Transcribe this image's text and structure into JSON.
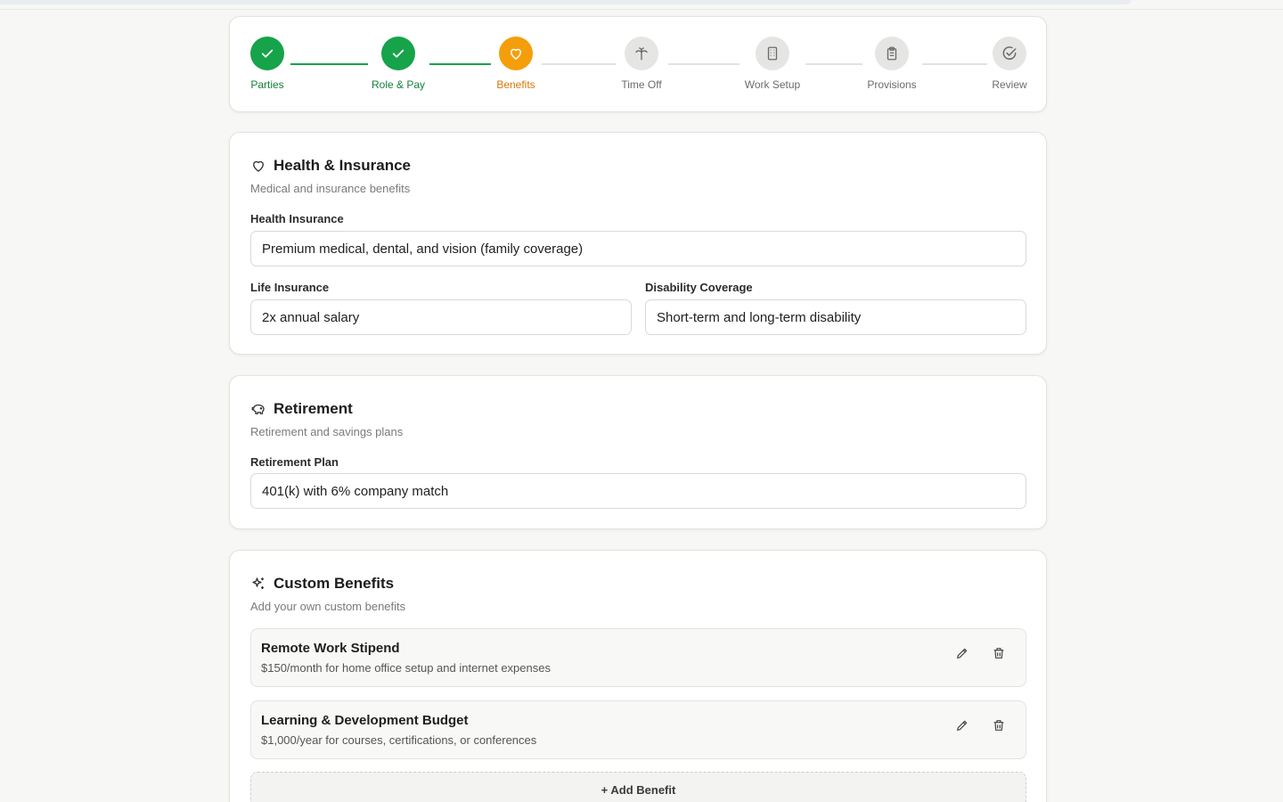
{
  "stepper": {
    "steps": [
      {
        "label": "Parties",
        "status": "done"
      },
      {
        "label": "Role & Pay",
        "status": "done"
      },
      {
        "label": "Benefits",
        "status": "active"
      },
      {
        "label": "Time Off",
        "status": "pending"
      },
      {
        "label": "Work Setup",
        "status": "pending"
      },
      {
        "label": "Provisions",
        "status": "pending"
      },
      {
        "label": "Review",
        "status": "pending"
      }
    ]
  },
  "health": {
    "title": "Health & Insurance",
    "subtitle": "Medical and insurance benefits",
    "health_insurance_label": "Health Insurance",
    "health_insurance_value": "Premium medical, dental, and vision (family coverage)",
    "life_insurance_label": "Life Insurance",
    "life_insurance_value": "2x annual salary",
    "disability_label": "Disability Coverage",
    "disability_value": "Short-term and long-term disability"
  },
  "retirement": {
    "title": "Retirement",
    "subtitle": "Retirement and savings plans",
    "plan_label": "Retirement Plan",
    "plan_value": "401(k) with 6% company match"
  },
  "custom": {
    "title": "Custom Benefits",
    "subtitle": "Add your own custom benefits",
    "items": [
      {
        "name": "Remote Work Stipend",
        "description": "$150/month for home office setup and internet expenses"
      },
      {
        "name": "Learning & Development Budget",
        "description": "$1,000/year for courses, certifications, or conferences"
      }
    ],
    "add_label": "+ Add Benefit"
  },
  "colors": {
    "done": "#16a34a",
    "active": "#f59e0b",
    "pending": "#e5e5e3"
  },
  "icons": {
    "done": "check-icon",
    "benefits": "heart-icon",
    "time_off": "palm-tree-icon",
    "work_setup": "building-icon",
    "provisions": "clipboard-icon",
    "review": "circle-check-icon",
    "retirement": "piggy-bank-icon",
    "custom": "sparkles-icon",
    "edit": "pencil-icon",
    "delete": "trash-icon"
  }
}
